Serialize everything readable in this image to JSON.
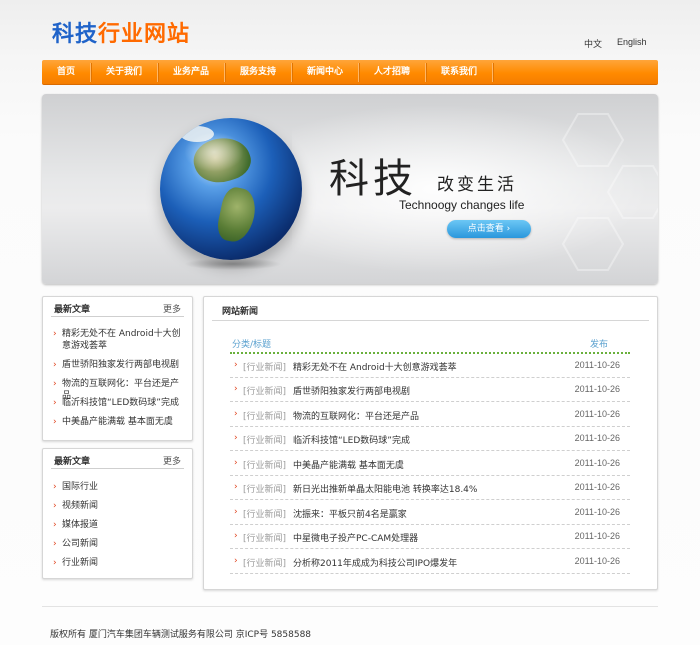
{
  "header": {
    "logo_part1": "科技",
    "logo_part2": "行业网站",
    "lang_zh": "中文",
    "lang_en": "English"
  },
  "nav": [
    "首页",
    "关于我们",
    "业务产品",
    "服务支持",
    "新闻中心",
    "人才招聘",
    "联系我们"
  ],
  "banner": {
    "big": "科技",
    "sub": "改变生活",
    "english": "Technoogy changes life",
    "button": "点击查看 ›"
  },
  "left_box1": {
    "title": "最新文章",
    "more": "更多",
    "items": [
      "精彩无处不在 Android十大创意游戏荟萃",
      "盾世骄阳独家发行两部电视剧",
      "物流的互联网化：平台还是产品",
      "临沂科技馆“LED数码球”完成",
      "中美晶产能满载 基本面无虞"
    ]
  },
  "left_box2": {
    "title": "最新文章",
    "more": "更多",
    "items": [
      "国际行业",
      "视频新闻",
      "媒体报道",
      "公司新闻",
      "行业新闻"
    ]
  },
  "news": {
    "title": "网站新闻",
    "col_category": "分类/标题",
    "col_date": "发布",
    "rows": [
      {
        "tag": "[行业新闻]",
        "title": "精彩无处不在 Android十大创意游戏荟萃",
        "date": "2011-10-26"
      },
      {
        "tag": "[行业新闻]",
        "title": "盾世骄阳独家发行两部电视剧",
        "date": "2011-10-26"
      },
      {
        "tag": "[行业新闻]",
        "title": "物流的互联网化：平台还是产品",
        "date": "2011-10-26"
      },
      {
        "tag": "[行业新闻]",
        "title": "临沂科技馆“LED数码球”完成",
        "date": "2011-10-26"
      },
      {
        "tag": "[行业新闻]",
        "title": "中美晶产能满载 基本面无虞",
        "date": "2011-10-26"
      },
      {
        "tag": "[行业新闻]",
        "title": "新日光出推新单晶太阳能电池 转换率达18.4%",
        "date": "2011-10-26"
      },
      {
        "tag": "[行业新闻]",
        "title": "沈振来：平板只前4名是赢家",
        "date": "2011-10-26"
      },
      {
        "tag": "[行业新闻]",
        "title": "中星微电子投产PC-CAM处理器",
        "date": "2011-10-26"
      },
      {
        "tag": "[行业新闻]",
        "title": "分析称2011年成成为科技公司IPO爆发年",
        "date": "2011-10-26"
      }
    ]
  },
  "footer": {
    "text": "版权所有 厦门汽车集团车辆测试服务有限公司   京ICP号 5858588"
  },
  "colors": {
    "nav_orange": "#ff8a00",
    "logo_blue": "#1f63c9",
    "logo_orange": "#ff6a00",
    "accent_blue": "#2a97dc",
    "arrow_red": "#e0401a"
  }
}
